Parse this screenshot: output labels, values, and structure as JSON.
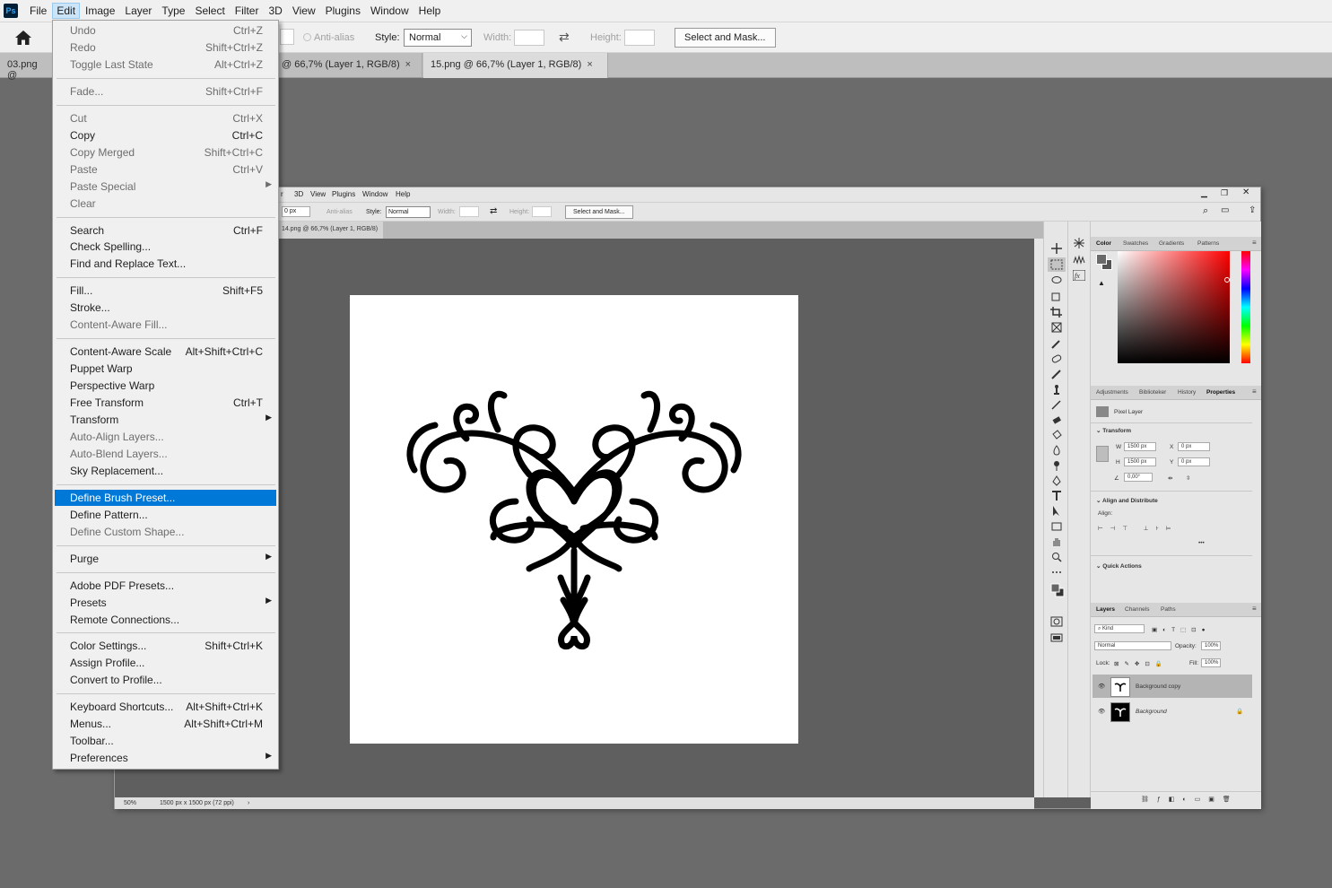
{
  "menubar": {
    "items": [
      "File",
      "Edit",
      "Image",
      "Layer",
      "Type",
      "Select",
      "Filter",
      "3D",
      "View",
      "Plugins",
      "Window",
      "Help"
    ],
    "active": "Edit"
  },
  "options": {
    "antialias": "Anti-alias",
    "style_label": "Style:",
    "style_value": "Normal",
    "width_label": "Width:",
    "height_label": "Height:",
    "select_mask": "Select and Mask..."
  },
  "tabs": [
    {
      "label": "03.png @"
    },
    {
      "label": "@ 66,7% (Layer 1, RGB/8)"
    },
    {
      "label": "15.png @ 66,7% (Layer 1, RGB/8)"
    }
  ],
  "edit_menu": [
    {
      "label": "Undo",
      "shortcut": "Ctrl+Z",
      "disabled": true
    },
    {
      "label": "Redo",
      "shortcut": "Shift+Ctrl+Z",
      "disabled": true
    },
    {
      "label": "Toggle Last State",
      "shortcut": "Alt+Ctrl+Z",
      "disabled": true
    },
    {
      "sep": true
    },
    {
      "label": "Fade...",
      "shortcut": "Shift+Ctrl+F",
      "disabled": true
    },
    {
      "sep": true
    },
    {
      "label": "Cut",
      "shortcut": "Ctrl+X",
      "disabled": true
    },
    {
      "label": "Copy",
      "shortcut": "Ctrl+C",
      "disabled": false
    },
    {
      "label": "Copy Merged",
      "shortcut": "Shift+Ctrl+C",
      "disabled": true
    },
    {
      "label": "Paste",
      "shortcut": "Ctrl+V",
      "disabled": true
    },
    {
      "label": "Paste Special",
      "shortcut": "",
      "disabled": true,
      "submenu": true
    },
    {
      "label": "Clear",
      "shortcut": "",
      "disabled": true
    },
    {
      "sep": true
    },
    {
      "label": "Search",
      "shortcut": "Ctrl+F",
      "disabled": false
    },
    {
      "label": "Check Spelling...",
      "shortcut": "",
      "disabled": false
    },
    {
      "label": "Find and Replace Text...",
      "shortcut": "",
      "disabled": false
    },
    {
      "sep": true
    },
    {
      "label": "Fill...",
      "shortcut": "Shift+F5",
      "disabled": false
    },
    {
      "label": "Stroke...",
      "shortcut": "",
      "disabled": false
    },
    {
      "label": "Content-Aware Fill...",
      "shortcut": "",
      "disabled": true
    },
    {
      "sep": true
    },
    {
      "label": "Content-Aware Scale",
      "shortcut": "Alt+Shift+Ctrl+C",
      "disabled": false
    },
    {
      "label": "Puppet Warp",
      "shortcut": "",
      "disabled": false
    },
    {
      "label": "Perspective Warp",
      "shortcut": "",
      "disabled": false
    },
    {
      "label": "Free Transform",
      "shortcut": "Ctrl+T",
      "disabled": false
    },
    {
      "label": "Transform",
      "shortcut": "",
      "disabled": false,
      "submenu": true
    },
    {
      "label": "Auto-Align Layers...",
      "shortcut": "",
      "disabled": true
    },
    {
      "label": "Auto-Blend Layers...",
      "shortcut": "",
      "disabled": true
    },
    {
      "label": "Sky Replacement...",
      "shortcut": "",
      "disabled": false
    },
    {
      "sep": true
    },
    {
      "label": "Define Brush Preset...",
      "shortcut": "",
      "disabled": false,
      "highlighted": true
    },
    {
      "label": "Define Pattern...",
      "shortcut": "",
      "disabled": false
    },
    {
      "label": "Define Custom Shape...",
      "shortcut": "",
      "disabled": true
    },
    {
      "sep": true
    },
    {
      "label": "Purge",
      "shortcut": "",
      "disabled": false,
      "submenu": true
    },
    {
      "sep": true
    },
    {
      "label": "Adobe PDF Presets...",
      "shortcut": "",
      "disabled": false
    },
    {
      "label": "Presets",
      "shortcut": "",
      "disabled": false,
      "submenu": true
    },
    {
      "label": "Remote Connections...",
      "shortcut": "",
      "disabled": false
    },
    {
      "sep": true
    },
    {
      "label": "Color Settings...",
      "shortcut": "Shift+Ctrl+K",
      "disabled": false
    },
    {
      "label": "Assign Profile...",
      "shortcut": "",
      "disabled": false
    },
    {
      "label": "Convert to Profile...",
      "shortcut": "",
      "disabled": false
    },
    {
      "sep": true
    },
    {
      "label": "Keyboard Shortcuts...",
      "shortcut": "Alt+Shift+Ctrl+K",
      "disabled": false
    },
    {
      "label": "Menus...",
      "shortcut": "Alt+Shift+Ctrl+M",
      "disabled": false
    },
    {
      "label": "Toolbar...",
      "shortcut": "",
      "disabled": false
    },
    {
      "label": "Preferences",
      "shortcut": "",
      "disabled": false,
      "submenu": true
    }
  ],
  "inner": {
    "menu": [
      "r",
      "3D",
      "View",
      "Plugins",
      "Window",
      "Help"
    ],
    "opt_px": "0 px",
    "opt_antialias": "Anti-alias",
    "opt_style": "Style:",
    "opt_style_value": "Normal",
    "opt_width": "Width:",
    "opt_height": "Height:",
    "opt_select_mask": "Select and Mask...",
    "tab": "14.png @ 66,7% (Layer 1, RGB/8)",
    "status_zoom": "50%",
    "status_size": "1500 px x 1500 px (72 ppi)",
    "color_tabs": [
      "Color",
      "Swatches",
      "Gradients",
      "Patterns"
    ],
    "prop_tabs": [
      "Adjustments",
      "Biblioteker",
      "History",
      "Properties"
    ],
    "pixel_layer": "Pixel Layer",
    "transform": "Transform",
    "w_label": "W",
    "w_value": "1500 px",
    "h_label": "H",
    "h_value": "1500 px",
    "x_label": "X",
    "x_value": "0 px",
    "y_label": "Y",
    "y_value": "0 px",
    "angle_value": "0,00°",
    "align_distribute": "Align and Distribute",
    "align_label": "Align:",
    "quick_actions": "Quick Actions",
    "layer_tabs": [
      "Layers",
      "Channels",
      "Paths"
    ],
    "kind": "Kind",
    "blend_mode": "Normal",
    "opacity_label": "Opacity:",
    "opacity_value": "100%",
    "lock_label": "Lock:",
    "fill_label": "Fill:",
    "fill_value": "100%",
    "layers": [
      "Background copy",
      "Background"
    ]
  }
}
